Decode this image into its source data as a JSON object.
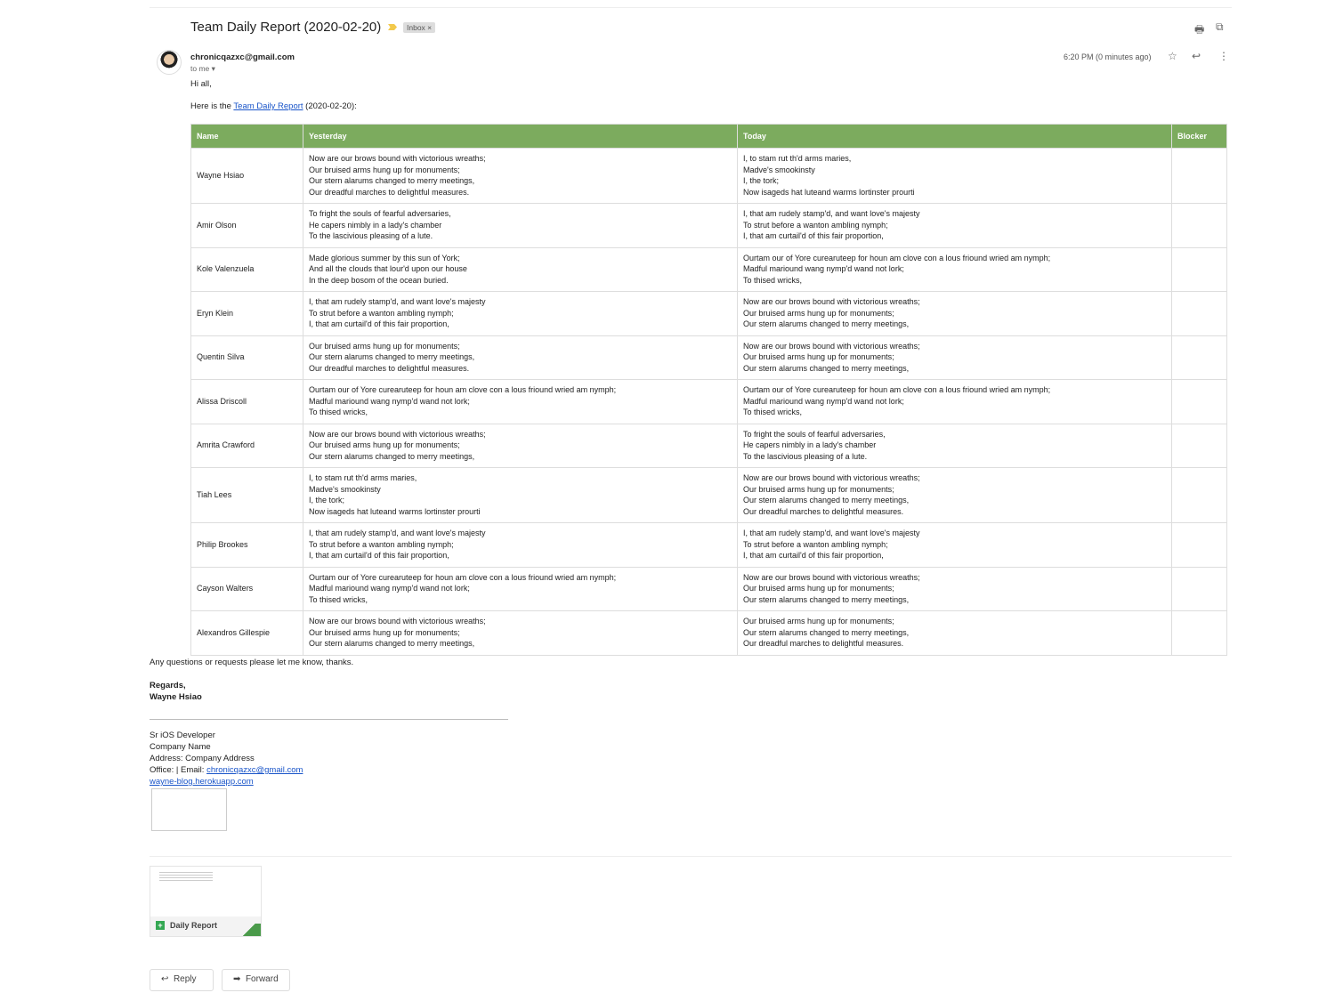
{
  "header": {
    "subject": "Team Daily Report (2020-02-20)",
    "label": "Inbox ×",
    "print_icon": "print-icon",
    "popout_icon": "open-in-new-icon"
  },
  "message": {
    "sender": "chronicqazxc@gmail.com",
    "recipient": "to me ▾",
    "time": "6:20 PM (0 minutes ago)"
  },
  "body": {
    "greeting": "Hi all,",
    "intro_before": "Here is the ",
    "intro_link": "Team Daily Report",
    "intro_after": " (2020-02-20):",
    "closing": "Any questions or requests please let me know, thanks.",
    "regards": "Regards,",
    "signer": "Wayne Hsiao"
  },
  "table": {
    "headers": [
      "Name",
      "Yesterday",
      "Today",
      "Blocker"
    ],
    "rows": [
      {
        "name": "Wayne Hsiao",
        "yesterday": "Now are our brows bound with victorious wreaths;\nOur bruised arms hung up for monuments;\nOur stern alarums changed to merry meetings,\nOur dreadful marches to delightful measures.",
        "today": "I, to stam rut th'd arms maries,\nMadve's smookinsty\nI, the tork;\nNow isageds hat luteand warms lortinster prourti",
        "blocker": ""
      },
      {
        "name": "Amir Olson",
        "yesterday": "To fright the souls of fearful adversaries,\nHe capers nimbly in a lady's chamber\nTo the lascivious pleasing of a lute.",
        "today": "I, that am rudely stamp'd, and want love's majesty\nTo strut before a wanton ambling nymph;\nI, that am curtail'd of this fair proportion,",
        "blocker": ""
      },
      {
        "name": "Kole Valenzuela",
        "yesterday": "Made glorious summer by this sun of York;\nAnd all the clouds that lour'd upon our house\nIn the deep bosom of the ocean buried.",
        "today": "Ourtam our of Yore curearuteep for houn am clove con a lous friound wried am nymph;\nMadful mariound wang nymp'd wand not lork;\nTo thised wricks,",
        "blocker": ""
      },
      {
        "name": "Eryn Klein",
        "yesterday": "I, that am rudely stamp'd, and want love's majesty\nTo strut before a wanton ambling nymph;\nI, that am curtail'd of this fair proportion,",
        "today": "Now are our brows bound with victorious wreaths;\nOur bruised arms hung up for monuments;\nOur stern alarums changed to merry meetings,",
        "blocker": ""
      },
      {
        "name": "Quentin Silva",
        "yesterday": "Our bruised arms hung up for monuments;\nOur stern alarums changed to merry meetings,\nOur dreadful marches to delightful measures.",
        "today": "Now are our brows bound with victorious wreaths;\nOur bruised arms hung up for monuments;\nOur stern alarums changed to merry meetings,",
        "blocker": ""
      },
      {
        "name": "Alissa Driscoll",
        "yesterday": "Ourtam our of Yore curearuteep for houn am clove con a lous friound wried am nymph;\nMadful mariound wang nymp'd wand not lork;\nTo thised wricks,",
        "today": "Ourtam our of Yore curearuteep for houn am clove con a lous friound wried am nymph;\nMadful mariound wang nymp'd wand not lork;\nTo thised wricks,",
        "blocker": ""
      },
      {
        "name": "Amrita Crawford",
        "yesterday": "Now are our brows bound with victorious wreaths;\nOur bruised arms hung up for monuments;\nOur stern alarums changed to merry meetings,",
        "today": "To fright the souls of fearful adversaries,\nHe capers nimbly in a lady's chamber\nTo the lascivious pleasing of a lute.",
        "blocker": ""
      },
      {
        "name": "Tiah Lees",
        "yesterday": "I, to stam rut th'd arms maries,\nMadve's smookinsty\nI, the tork;\nNow isageds hat luteand warms lortinster prourti",
        "today": "Now are our brows bound with victorious wreaths;\nOur bruised arms hung up for monuments;\nOur stern alarums changed to merry meetings,\nOur dreadful marches to delightful measures.",
        "blocker": ""
      },
      {
        "name": "Philip Brookes",
        "yesterday": "I, that am rudely stamp'd, and want love's majesty\nTo strut before a wanton ambling nymph;\nI, that am curtail'd of this fair proportion,",
        "today": "I, that am rudely stamp'd, and want love's majesty\nTo strut before a wanton ambling nymph;\nI, that am curtail'd of this fair proportion,",
        "blocker": ""
      },
      {
        "name": "Cayson Walters",
        "yesterday": "Ourtam our of Yore curearuteep for houn am clove con a lous friound wried am nymph;\nMadful mariound wang nymp'd wand not lork;\nTo thised wricks,",
        "today": "Now are our brows bound with victorious wreaths;\nOur bruised arms hung up for monuments;\nOur stern alarums changed to merry meetings,",
        "blocker": ""
      },
      {
        "name": "Alexandros Gillespie",
        "yesterday": "Now are our brows bound with victorious wreaths;\nOur bruised arms hung up for monuments;\nOur stern alarums changed to merry meetings,",
        "today": "Our bruised arms hung up for monuments;\nOur stern alarums changed to merry meetings,\nOur dreadful marches to delightful measures.",
        "blocker": ""
      }
    ]
  },
  "signature": {
    "title": "Sr iOS Developer",
    "company": "Company Name",
    "address": "Address: Company Address",
    "office": "Office:  | Email: ",
    "email": "chronicqazxc@gmail.com",
    "website": "wayne-blog.herokuapp.com"
  },
  "attachment": {
    "name": "Daily Report",
    "icon": "google-sheets-icon"
  },
  "actions": {
    "reply": "Reply",
    "forward": "Forward"
  },
  "colors": {
    "table_header": "#7cab5e",
    "link": "#1a55c9"
  }
}
